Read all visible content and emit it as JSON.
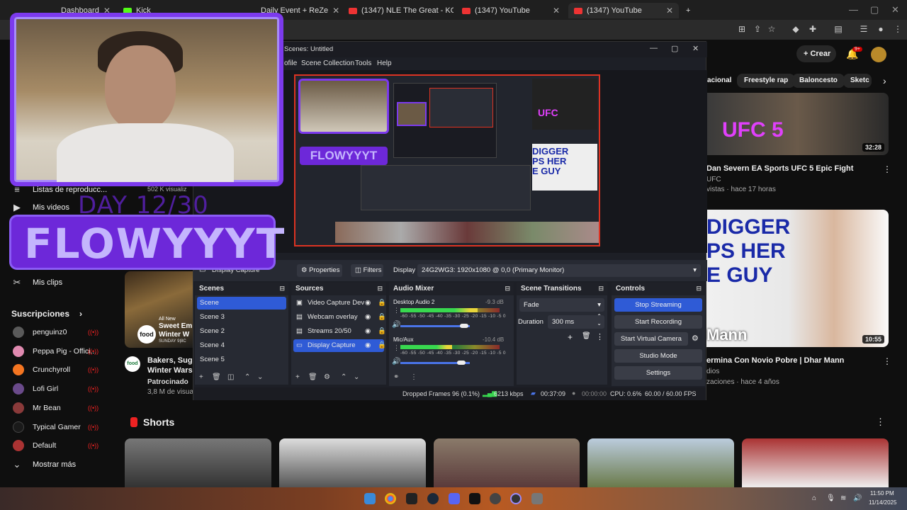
{
  "browser": {
    "tabs": [
      {
        "label": "Dashboard"
      },
      {
        "label": "Kick"
      },
      {
        "label": "Daily Event + ReZe"
      },
      {
        "label": "(1347) NLE The Great - KO (Offi"
      },
      {
        "label": "(1347) YouTube"
      },
      {
        "label": "(1347) YouTube"
      }
    ],
    "new_tab": "+"
  },
  "youtube": {
    "create_label": "Crear",
    "notif_badge": "9+",
    "chips": [
      "acional",
      "Freestyle rap",
      "Baloncesto",
      "Sketc"
    ],
    "sidebar": {
      "items": [
        {
          "icon": "playlist-icon",
          "label": "Listas de reproducc..."
        },
        {
          "icon": "video-icon",
          "label": "Mis videos"
        },
        {
          "icon": "clips-icon",
          "label": "Mis clips"
        }
      ],
      "subs_header": "Suscripciones",
      "subscriptions": [
        {
          "name": "penguinz0",
          "color": "#5a5a5a"
        },
        {
          "name": "Peppa Pig - Offici...",
          "color": "#e08ab0"
        },
        {
          "name": "Crunchyroll",
          "color": "#f47521"
        },
        {
          "name": "Lofi Girl",
          "color": "#6a4a8a"
        },
        {
          "name": "Mr Bean",
          "color": "#8a3a3a"
        },
        {
          "name": "Typical Gamer",
          "color": "#1a1a1a"
        },
        {
          "name": "Default",
          "color": "#a33"
        }
      ],
      "show_more": "Mostrar más"
    },
    "partial_left": {
      "views_label": "502 K visualiz",
      "ad_title_1": "Bakers, Sugar",
      "ad_title_2": "Winter Wars S",
      "ad_sponsor": "Patrocinado",
      "ad_views": "3,8 M de visual",
      "ad_overlay_1": "All New",
      "ad_overlay_2": "Sweet Em",
      "ad_overlay_3": "Winter W",
      "ad_overlay_4": "SUNDAY 9|8C",
      "food_logo": "food"
    },
    "video_top": {
      "title": "Dan Severn   EA Sports UFC 5   Epic Fight",
      "channel": "UFC",
      "meta": "vistas · hace 17 horas",
      "duration": "32:28",
      "thumb_text": "UFC 5"
    },
    "video_mid": {
      "title": "ermina Con Novio Pobre | Dhar Mann",
      "channel": "dios",
      "meta": "zaciones · hace 4 años",
      "duration": "10:55",
      "thumb_line1": "DIGGER",
      "thumb_line2": "PS HER",
      "thumb_line3": "E GUY",
      "thumb_brand": "Mann"
    },
    "shorts_label": "Shorts"
  },
  "obs": {
    "title": "Scenes: Untitled",
    "menu": [
      "ofile",
      "Scene Collection",
      "Tools",
      "Help"
    ],
    "source_toolbar": {
      "current_source": "Display Capture",
      "properties": "Properties",
      "filters": "Filters",
      "display_label": "Display",
      "display_value": "24G2WG3: 1920x1080 @ 0,0 (Primary Monitor)"
    },
    "scenes": {
      "header": "Scenes",
      "items": [
        "Scene",
        "Scene 3",
        "Scene 2",
        "Scene 4",
        "Scene 5"
      ],
      "selected": 0
    },
    "sources": {
      "header": "Sources",
      "items": [
        "Video Capture Dev",
        "Webcam overlay",
        "Streams 20/50",
        "Display Capture"
      ],
      "selected": 3
    },
    "mixer": {
      "header": "Audio Mixer",
      "channels": [
        {
          "name": "Desktop Audio 2",
          "db": "-9.3 dB",
          "level": 0.78,
          "volume": 0.92
        },
        {
          "name": "Mic/Aux",
          "db": "-10.4 dB",
          "level": 0.52,
          "volume": 0.88
        }
      ],
      "scale": "-60 -55 -50 -45 -40 -35 -30 -25 -20 -15 -10 -5 0"
    },
    "transitions": {
      "header": "Scene Transitions",
      "type": "Fade",
      "duration_label": "Duration",
      "duration_value": "300 ms"
    },
    "controls": {
      "header": "Controls",
      "buttons": [
        "Stop Streaming",
        "Start Recording",
        "Start Virtual Camera",
        "Studio Mode",
        "Settings"
      ]
    },
    "status": {
      "dropped": "Dropped Frames 96 (0.1%)",
      "bitrate": "6213 kbps",
      "stream_time": "00:37:09",
      "rec_time": "00:00:00",
      "cpu": "CPU: 0.6%",
      "fps": "60.00 / 60.00 FPS"
    },
    "preview": {
      "overlay_name": "FLOWYYYT",
      "thumb_text_1": "DIGGER",
      "thumb_text_2": "PS HER",
      "thumb_text_3": "E GUY",
      "ufc": "UFC"
    }
  },
  "overlay": {
    "day": "DAY 12/30",
    "name": "FLOWYYYT"
  },
  "taskbar": {
    "time": "11:50 PM",
    "date": "11/14/2025"
  },
  "colors": {
    "obs_accent": "#2f5bd6",
    "overlay_purple": "#7c3aed",
    "live_red": "#e22"
  }
}
